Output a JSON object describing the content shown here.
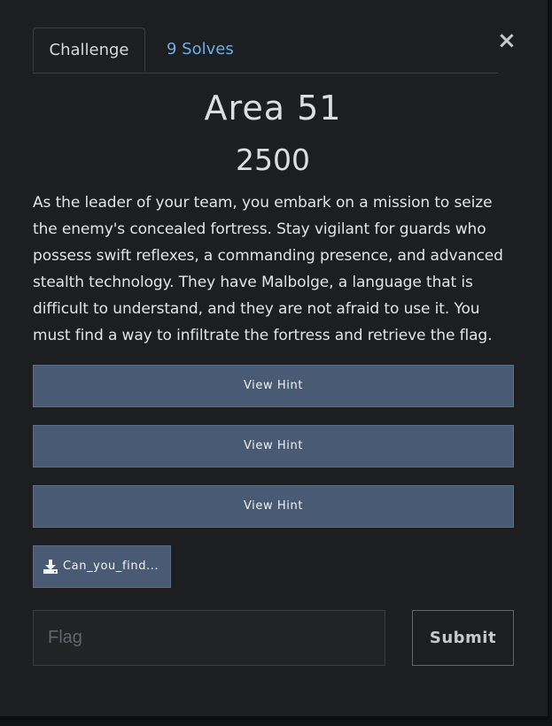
{
  "tabs": {
    "challenge_label": "Challenge",
    "solves_label": "9 Solves"
  },
  "close_glyph": "×",
  "challenge": {
    "title": "Area 51",
    "points": "2500",
    "description": "As the leader of your team, you embark on a mission to seize the enemy's concealed fortress. Stay vigilant for guards who possess swift reflexes, a commanding presence, and advanced stealth technology. They have Malbolge, a language that is difficult to understand, and they are not afraid to use it. You must find a way to infiltrate the fortress and retrieve the flag."
  },
  "hints": [
    {
      "label": "View Hint"
    },
    {
      "label": "View Hint"
    },
    {
      "label": "View Hint"
    }
  ],
  "file": {
    "label": "Can_you_find...",
    "icon": "download-icon"
  },
  "flag": {
    "placeholder": "Flag",
    "value": ""
  },
  "submit_label": "Submit",
  "colors": {
    "background": "#1c1e20",
    "hint_button": "#495b74",
    "link": "#6eaee6"
  }
}
